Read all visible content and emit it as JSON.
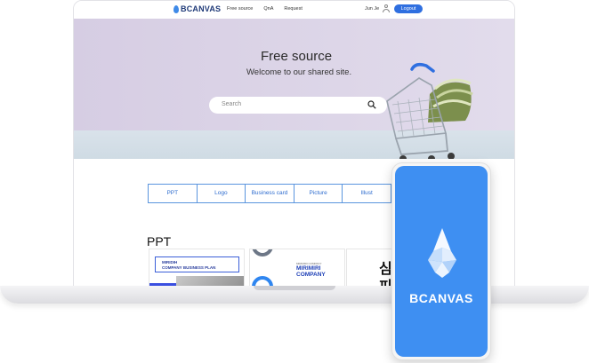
{
  "header": {
    "logo_text": "BCANVAS",
    "nav": [
      "Free source",
      "QnA",
      "Request"
    ],
    "user_name": "Jun Je",
    "logout_label": "Logout"
  },
  "hero": {
    "title": "Free source",
    "subtitle": "Welcome to our shared site.",
    "search_placeholder": "Search"
  },
  "categories": [
    "PPT",
    "Logo",
    "Business card",
    "Picture",
    "Illust"
  ],
  "section": {
    "title": "PPT"
  },
  "thumbnails": [
    {
      "line1": "MIRIDIH",
      "line2": "COMPANY BUSINESS PLAN"
    },
    {
      "small": "MIRIMIRI COMPANY",
      "line1": "MIRIMIRI",
      "line2": "COMPANY"
    },
    {
      "line1": "심",
      "line2": "피"
    }
  ],
  "phone": {
    "brand": "BCANVAS"
  },
  "colors": {
    "brand_blue": "#3e8ff2",
    "logout_blue": "#2f6fe0",
    "hero_bg": "#d6cde3"
  },
  "icons": {
    "search": "search-icon",
    "user": "user-icon",
    "cart": "shopping-cart-icon",
    "brand_mark": "bcanvas-drop-icon"
  }
}
